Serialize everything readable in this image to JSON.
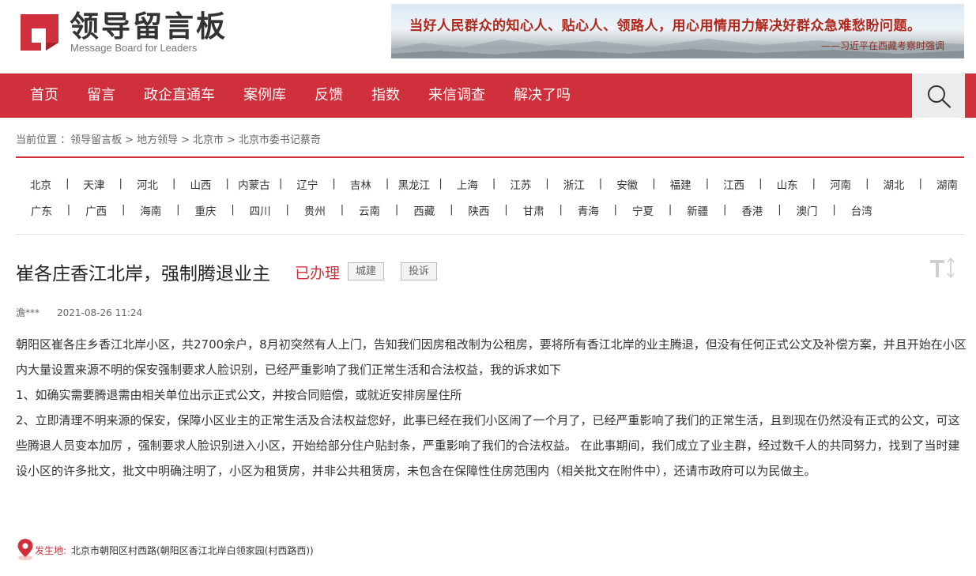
{
  "header": {
    "logo_title": "领导留言板",
    "logo_subtitle": "Message Board for Leaders",
    "banner_quote": "当好人民群众的知心人、贴心人、领路人，用心用情用力解决好群众急难愁盼问题。",
    "banner_source": "——习近平在西藏考察时强调"
  },
  "nav": {
    "items": [
      "首页",
      "留言",
      "政企直通车",
      "案例库",
      "反馈",
      "指数",
      "来信调查",
      "解决了吗"
    ],
    "search_icon": "search-icon"
  },
  "breadcrumb": {
    "prefix": "当前位置 ：",
    "items": [
      "领导留言板",
      "地方领导",
      "北京市",
      "北京市委书记蔡奇"
    ],
    "separator": ">"
  },
  "provinces": {
    "row1": [
      "北京",
      "天津",
      "河北",
      "山西",
      "内蒙古",
      "辽宁",
      "吉林",
      "黑龙江",
      "上海",
      "江苏",
      "浙江",
      "安徽",
      "福建",
      "江西",
      "山东",
      "河南",
      "湖北",
      "湖南"
    ],
    "row2": [
      "广东",
      "广西",
      "海南",
      "重庆",
      "四川",
      "贵州",
      "云南",
      "西藏",
      "陕西",
      "甘肃",
      "青海",
      "宁夏",
      "新疆",
      "香港",
      "澳门",
      "台湾"
    ],
    "separator": "|"
  },
  "message": {
    "title": "崔各庄香江北岸，强制腾退业主",
    "status": "已办理",
    "tags": [
      "城建",
      "投诉"
    ],
    "author": "澹***",
    "date": "2021-08-26 11:24",
    "paragraphs": [
      "朝阳区崔各庄乡香江北岸小区，共2700余户，8月初突然有人上门，告知我们因房租改制为公租房，要将所有香江北岸的业主腾退，但没有任何正式公文及补偿方案，并且开始在小区内大量设置来源不明的保安强制要求人脸识别，已经严重影响了我们正常生活和合法权益，我的诉求如下",
      "1、如确实需要腾退需由相关单位出示正式公文，并按合同赔偿，或就近安排房屋住所",
      "2、立即清理不明来源的保安，保障小区业主的正常生活及合法权益您好，此事已经在我们小区闹了一个月了，已经严重影响了我们的正常生活，且到现在仍然没有正式的公文，可这些腾退人员变本加厉 ，强制要求人脸识别进入小区，开始给部分住户贴封条，严重影响了我们的合法权益。 在此事期间，我们成立了业主群，经过数千人的共同努力，找到了当时建设小区的许多批文，批文中明确注明了，小区为租赁房，并非公共租赁房，未包含在保障性住房范围内（相关批文在附件中），还请市政府可以为民做主。"
    ],
    "location_label": "发生地:",
    "location_value": "北京市朝阳区村西路(朝阳区香江北岸白领家园(村西路西))"
  },
  "colors": {
    "brand_red": "#d0303b",
    "text": "#333333"
  }
}
